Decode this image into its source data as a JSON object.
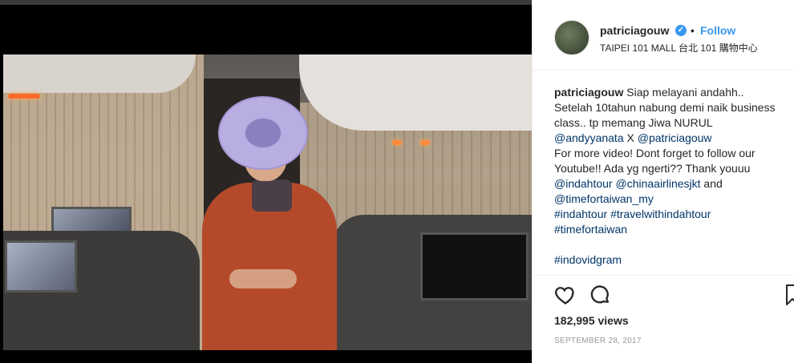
{
  "post": {
    "username": "patriciagouw",
    "follow_label": "Follow",
    "separator": "•",
    "location": "TAIPEI 101 MALL 台北 101 購物中心",
    "verified_glyph": "✓",
    "caption_lines": [
      {
        "user": "patriciagouw",
        "text": " Siap melayani andahh.."
      },
      {
        "text": "Setelah 10tahun nabung demi naik business"
      },
      {
        "text": "class.. tp memang Jiwa NURUL"
      },
      {
        "link1": "@andyyanata",
        "mid": " X ",
        "link2": "@patriciagouw"
      },
      {
        "text": "For more video! Dont forget to follow our"
      },
      {
        "text": "Youtube!! Ada yg ngerti?? Thank youuu"
      },
      {
        "link1": "@indahtour",
        "mid": " ",
        "link2": "@chinaairlinesjkt",
        "tail": " and"
      },
      {
        "link1": "@timefortaiwan_my"
      },
      {
        "link1": "#indahtour",
        "mid": " ",
        "link2": "#travelwithindahtour"
      },
      {
        "link1": "#timefortaiwan"
      },
      {
        "link1": "#indovidgram"
      }
    ],
    "views": "182,995 views",
    "date": "SEPTEMBER 28, 2017"
  },
  "icons": {
    "like": "heart-icon",
    "comment": "comment-icon",
    "save": "bookmark-icon",
    "verified": "verified-badge-icon"
  },
  "colors": {
    "accent": "#3897f0",
    "link": "#003569",
    "text": "#262626",
    "muted": "#999999"
  }
}
